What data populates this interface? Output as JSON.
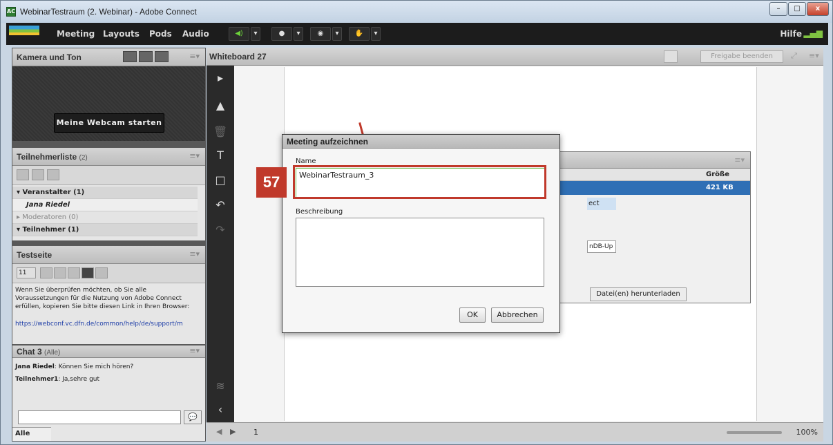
{
  "window": {
    "title": "WebinarTestraum (2. Webinar) - Adobe Connect",
    "controls": {
      "minimize": "–",
      "maximize": "□",
      "close": "x"
    }
  },
  "menubar": {
    "items": [
      "Meeting",
      "Layouts",
      "Pods",
      "Audio"
    ],
    "help": "Hilfe"
  },
  "camera_pod": {
    "title": "Kamera und Ton",
    "start_button": "Meine Webcam starten"
  },
  "participants_pod": {
    "title": "Teilnehmerliste",
    "count": "(2)",
    "groups": [
      {
        "label": "▾ Veranstalter (1)"
      },
      {
        "label": "Jana Riedel",
        "is_person": true
      },
      {
        "label": "▸ Moderatoren (0)"
      },
      {
        "label": "▾ Teilnehmer (1)"
      }
    ]
  },
  "notes_pod": {
    "title": "Testseite",
    "font_size": "11",
    "body": "Wenn Sie überprüfen möchten, ob Sie alle Voraussetzungen für die Nutzung von Adobe Connect erfüllen, kopieren Sie bitte diesen Link in Ihren Browser:",
    "link": "https://webconf.vc.dfn.de/common/help/de/support/m"
  },
  "chat_pod": {
    "title": "Chat 3",
    "scope": "(Alle)",
    "messages": [
      {
        "sender": "Jana Riedel",
        "text": ": Können Sie mich hören?"
      },
      {
        "sender": "Teilnehmer1",
        "text": ": Ja,sehre gut"
      }
    ],
    "recipient": "Alle"
  },
  "whiteboard": {
    "title": "Whiteboard 27",
    "stop_share": "Freigabe beenden",
    "page_number": "1",
    "zoom": "100%"
  },
  "file_pod": {
    "column_size": "Größe",
    "selected_size": "421 KB",
    "fragment_1": "ect",
    "fragment_2": "nDB-Up",
    "download_button": "Datei(en) herunterladen"
  },
  "dialog": {
    "title": "Meeting aufzeichnen",
    "name_label": "Name",
    "name_value": "WebinarTestraum_3",
    "description_label": "Beschreibung",
    "description_value": "",
    "ok_label": "OK",
    "cancel_label": "Abbrechen"
  },
  "annotation": {
    "step_number": "57",
    "color": "#c0392b"
  }
}
